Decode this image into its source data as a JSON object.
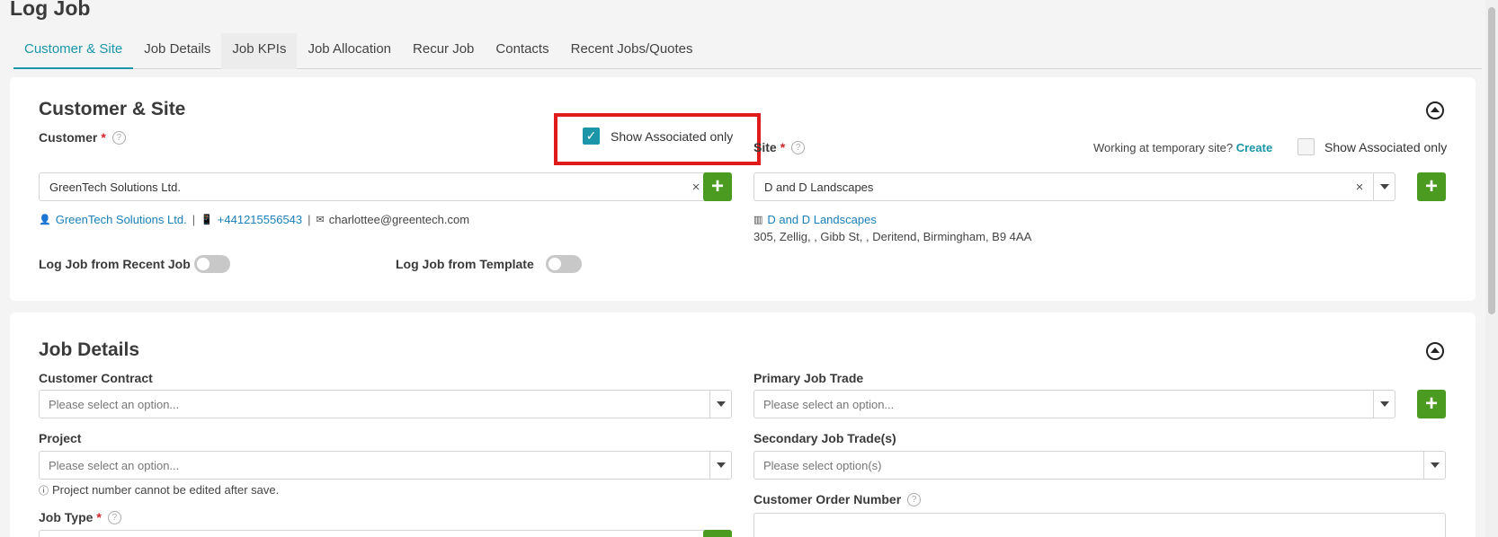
{
  "page": {
    "title": "Log Job"
  },
  "tabs": [
    {
      "label": "Customer & Site"
    },
    {
      "label": "Job Details"
    },
    {
      "label": "Job KPIs"
    },
    {
      "label": "Job Allocation"
    },
    {
      "label": "Recur Job"
    },
    {
      "label": "Contacts"
    },
    {
      "label": "Recent Jobs/Quotes"
    }
  ],
  "customer_site": {
    "title": "Customer & Site",
    "customer_label": "Customer",
    "required_mark": "*",
    "help_glyph": "?",
    "customer_value": "GreenTech Solutions Ltd.",
    "customer_show_associated": {
      "label": "Show Associated only",
      "checked": true
    },
    "customer_info": {
      "name": "GreenTech Solutions Ltd.",
      "phone": "+441215556543",
      "email": "charlottee@greentech.com",
      "separator": "|"
    },
    "log_from_recent_label": "Log Job from Recent Job",
    "log_from_template_label": "Log Job from Template",
    "site_label": "Site",
    "temp_site_text": "Working at temporary site?",
    "temp_site_link": "Create",
    "site_show_associated": {
      "label": "Show Associated only",
      "checked": false
    },
    "site_value": "D and D Landscapes",
    "site_info": {
      "name": "D and D Landscapes",
      "address": "305, Zellig, , Gibb St, , Deritend, Birmingham, B9 4AA"
    },
    "clear_glyph": "×",
    "plus_glyph": "+"
  },
  "job_details": {
    "title": "Job Details",
    "customer_contract_label": "Customer Contract",
    "customer_contract_placeholder": "Please select an option...",
    "project_label": "Project",
    "project_placeholder": "Please select an option...",
    "project_note": "Project number cannot be edited after save.",
    "job_type_label": "Job Type",
    "primary_trade_label": "Primary Job Trade",
    "primary_trade_placeholder": "Please select an option...",
    "secondary_trade_label": "Secondary Job Trade(s)",
    "secondary_trade_placeholder": "Please select option(s)",
    "order_number_label": "Customer Order Number"
  },
  "colors": {
    "accent": "#1a96a8",
    "add_button": "#4a9b1f",
    "highlight": "#e01b1b",
    "link": "#1a7fb8"
  }
}
